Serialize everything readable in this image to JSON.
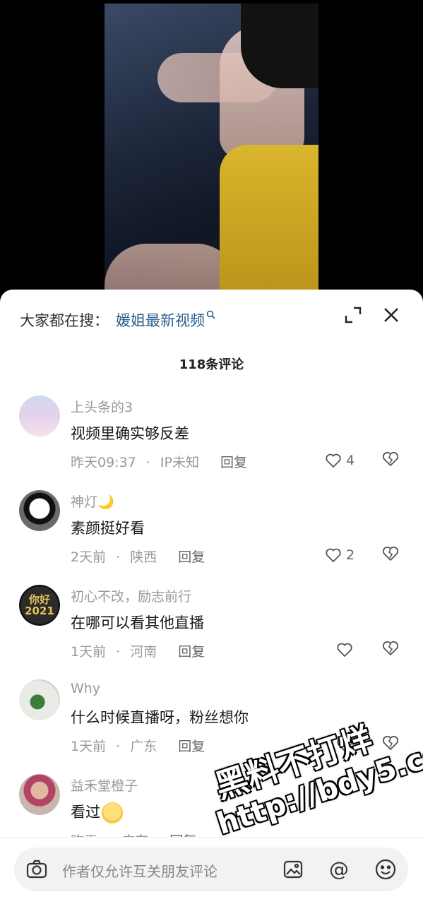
{
  "search": {
    "prefix": "大家都在搜：",
    "query": "媛姐最新视频",
    "mini_icon": "magnifier"
  },
  "comments_count": "118条评论",
  "comments": [
    {
      "user": "上头条的3",
      "text": "视频里确实够反差",
      "time": "昨天09:37",
      "sep": "·",
      "location": "IP未知",
      "reply": "回复",
      "likes": "4"
    },
    {
      "user": "神灯",
      "user_emoji": "🌙",
      "text": "素颜挺好看",
      "time": "2天前",
      "sep": "·",
      "location": "陕西",
      "reply": "回复",
      "likes": "2",
      "avatar_text": ""
    },
    {
      "user": "初心不改，励志前行",
      "text": "在哪可以看其他直播",
      "time": "1天前",
      "sep": "·",
      "location": "河南",
      "reply": "回复",
      "likes": "",
      "avatar_text": "你好\n2021"
    },
    {
      "user": "Why",
      "text": "什么时候直播呀，粉丝想你",
      "time": "1天前",
      "sep": "·",
      "location": "广东",
      "reply": "回复",
      "likes": ""
    },
    {
      "user": "益禾堂橙子",
      "text": "看过",
      "time": "昨天",
      "sep": "·",
      "location": "广东",
      "reply": "回复",
      "likes": ""
    }
  ],
  "input": {
    "placeholder": "作者仅允许互关朋友评论"
  },
  "watermark": {
    "line1": "黑料不打烊",
    "line2": "http://bdy5.co"
  },
  "colors": {
    "link": "#2a5d8f",
    "muted": "#999999",
    "sheet": "#ffffff",
    "background": "#000000"
  }
}
